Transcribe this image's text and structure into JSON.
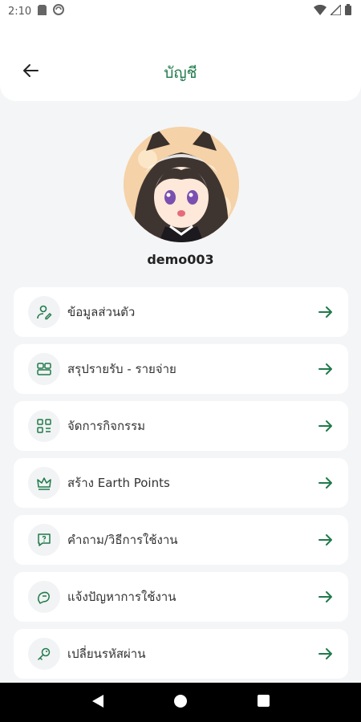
{
  "status_bar": {
    "time": "2:10",
    "icons": [
      "sd-card-icon",
      "sync-icon",
      "wifi-icon",
      "signal-icon",
      "battery-icon"
    ]
  },
  "appbar": {
    "title": "บัญชี",
    "back_icon": "arrow-left-icon"
  },
  "profile": {
    "username": "demo003",
    "avatar_icon": "anime-avatar"
  },
  "menu": [
    {
      "label": "ข้อมูลส่วนตัว",
      "icon": "user-edit-icon"
    },
    {
      "label": "สรุปรายรับ - รายจ่าย",
      "icon": "wallet-summary-icon"
    },
    {
      "label": "จัดการกิจกรรม",
      "icon": "activity-grid-icon"
    },
    {
      "label": "สร้าง Earth Points",
      "icon": "crown-icon"
    },
    {
      "label": "คำถาม/วิธีการใช้งาน",
      "icon": "question-chat-icon"
    },
    {
      "label": "แจ้งปัญหาการใช้งาน",
      "icon": "report-chat-icon"
    },
    {
      "label": "เปลี่ยนรหัสผ่าน",
      "icon": "key-icon"
    }
  ],
  "nav_bar": {
    "icons": [
      "nav-back-icon",
      "nav-home-icon",
      "nav-recents-icon"
    ]
  },
  "colors": {
    "accent": "#1f7a4a",
    "background": "#f4f5f7",
    "card": "#ffffff"
  }
}
